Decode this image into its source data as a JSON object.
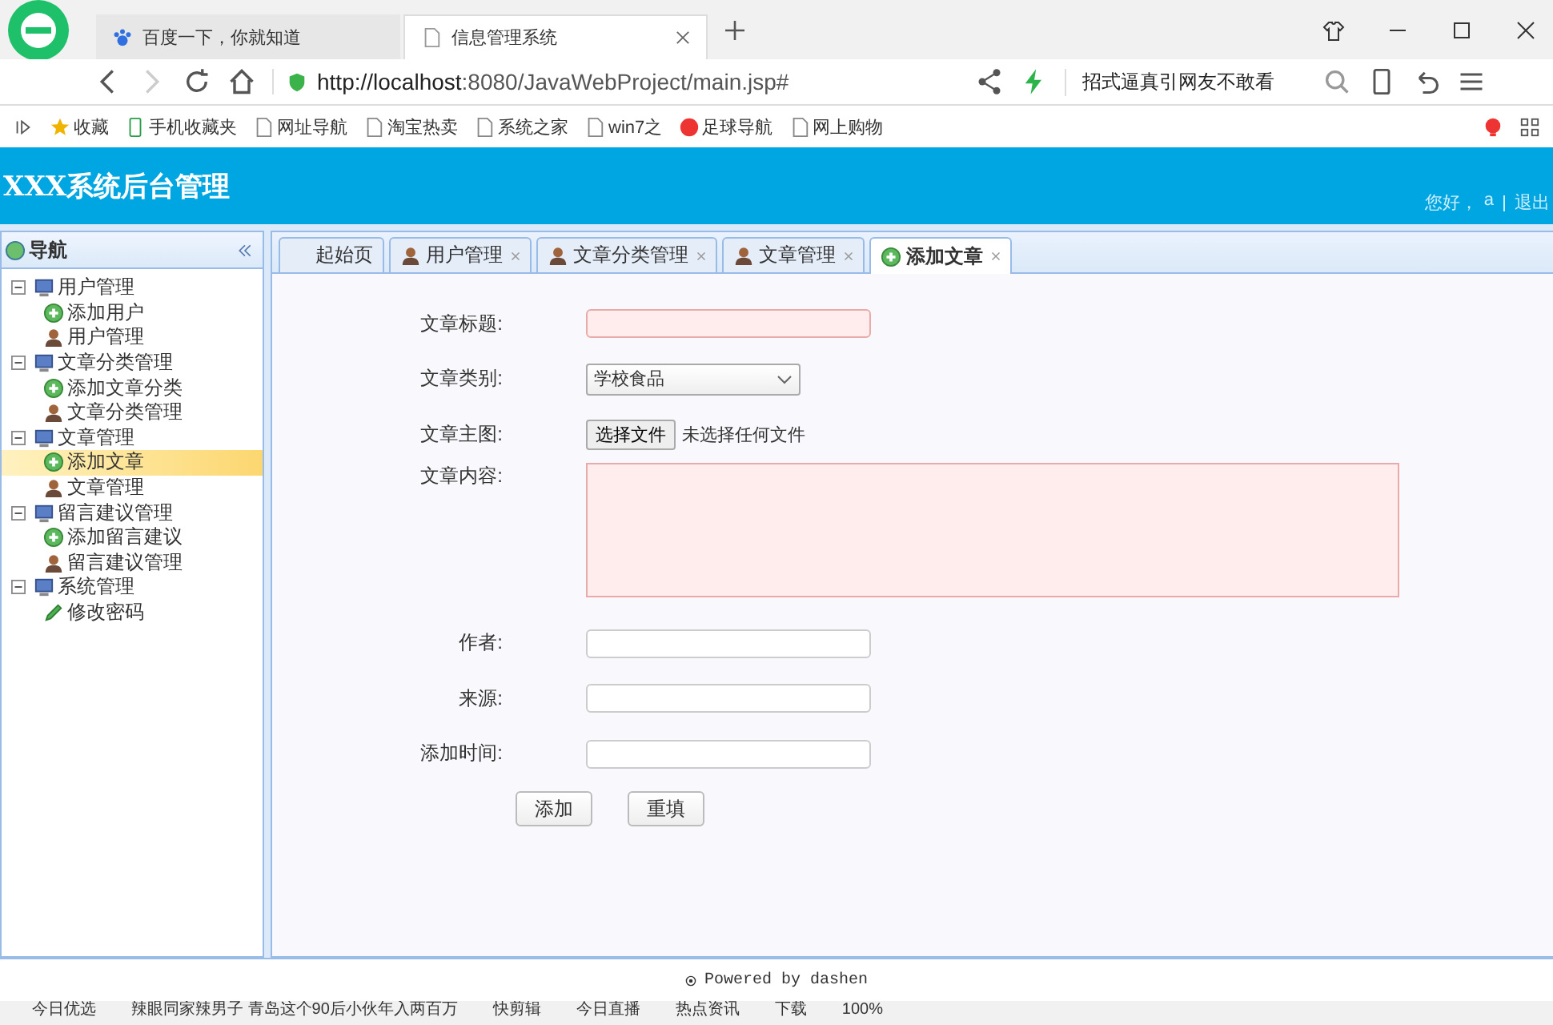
{
  "browser": {
    "tabs": [
      {
        "title": "百度一下，你就知道",
        "selected": false
      },
      {
        "title": "信息管理系统",
        "selected": true
      }
    ],
    "url_host": "http://localhost",
    "url_rest": ":8080/JavaWebProject/main.jsp#",
    "search_text": "招式逼真引网友不敢看",
    "bookmarks": [
      {
        "label": "收藏",
        "kind": "star"
      },
      {
        "label": "手机收藏夹",
        "kind": "phone"
      },
      {
        "label": "网址导航",
        "kind": "page"
      },
      {
        "label": "淘宝热卖",
        "kind": "page"
      },
      {
        "label": "系统之家",
        "kind": "page"
      },
      {
        "label": "win7之",
        "kind": "page"
      },
      {
        "label": "足球导航",
        "kind": "ball"
      },
      {
        "label": "网上购物",
        "kind": "page"
      }
    ]
  },
  "header": {
    "title": "XXX系统后台管理",
    "greeting": "您好，",
    "user": "a",
    "logout": "退出"
  },
  "nav": {
    "title": "导航",
    "tree": [
      {
        "label": "用户管理",
        "expanded": true,
        "children": [
          {
            "label": "添加用户",
            "kind": "add",
            "selected": false
          },
          {
            "label": "用户管理",
            "kind": "user",
            "selected": false
          }
        ]
      },
      {
        "label": "文章分类管理",
        "expanded": true,
        "children": [
          {
            "label": "添加文章分类",
            "kind": "add",
            "selected": false
          },
          {
            "label": "文章分类管理",
            "kind": "user",
            "selected": false
          }
        ]
      },
      {
        "label": "文章管理",
        "expanded": true,
        "children": [
          {
            "label": "添加文章",
            "kind": "add",
            "selected": true
          },
          {
            "label": "文章管理",
            "kind": "user",
            "selected": false
          }
        ]
      },
      {
        "label": "留言建议管理",
        "expanded": true,
        "children": [
          {
            "label": "添加留言建议",
            "kind": "add",
            "selected": false
          },
          {
            "label": "留言建议管理",
            "kind": "user",
            "selected": false
          }
        ]
      },
      {
        "label": "系统管理",
        "expanded": true,
        "children": [
          {
            "label": "修改密码",
            "kind": "edit",
            "selected": false
          }
        ]
      }
    ]
  },
  "tabs": [
    {
      "label": "起始页",
      "kind": "none",
      "closable": false,
      "selected": false
    },
    {
      "label": "用户管理",
      "kind": "user",
      "closable": true,
      "selected": false
    },
    {
      "label": "文章分类管理",
      "kind": "user",
      "closable": true,
      "selected": false
    },
    {
      "label": "文章管理",
      "kind": "user",
      "closable": true,
      "selected": false
    },
    {
      "label": "添加文章",
      "kind": "add",
      "closable": true,
      "selected": true
    }
  ],
  "form": {
    "fields": [
      {
        "label": "文章标题:",
        "kind": "text",
        "required": true
      },
      {
        "label": "文章类别:",
        "kind": "select",
        "value": "学校食品"
      },
      {
        "label": "文章主图:",
        "kind": "file",
        "button": "选择文件",
        "value": "未选择任何文件"
      },
      {
        "label": "文章内容:",
        "kind": "textarea",
        "required": true
      },
      {
        "label": "作者:",
        "kind": "text",
        "required": false
      },
      {
        "label": "来源:",
        "kind": "text",
        "required": false
      },
      {
        "label": "添加时间:",
        "kind": "text",
        "required": false
      }
    ],
    "buttons": [
      "添加",
      "重填"
    ]
  },
  "footer": "Powered by dashen",
  "status_bar": [
    "今日优选",
    "辣眼同家辣男子 青岛这个90后小伙年入两百万",
    "快剪辑",
    "今日直播",
    "热点资讯",
    "下载",
    "100%"
  ]
}
